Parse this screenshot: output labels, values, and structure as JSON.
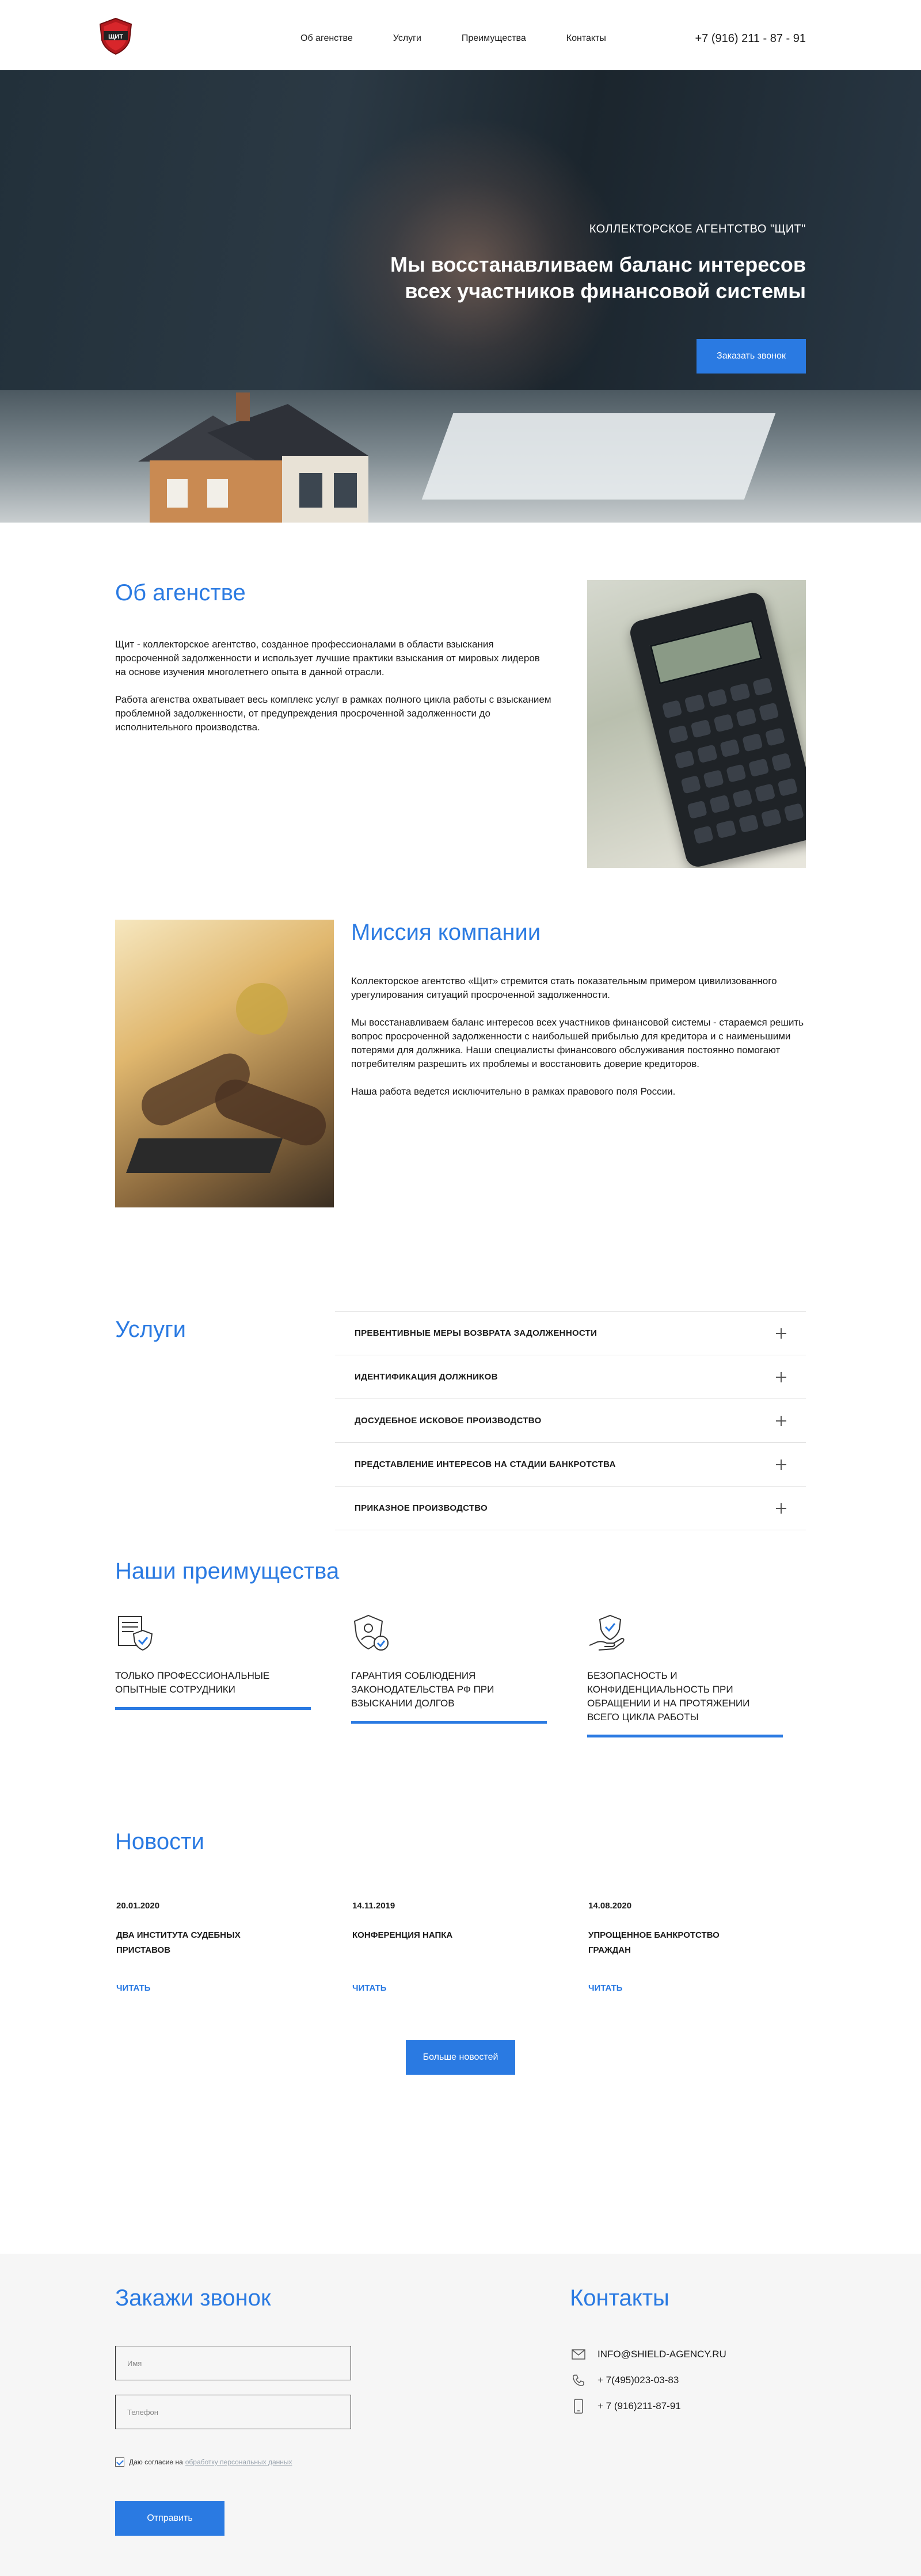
{
  "header": {
    "nav": [
      "Об агенстве",
      "Услуги",
      "Преимущества",
      "Контакты"
    ],
    "phone": "+7 (916) 211 - 87 - 91"
  },
  "hero": {
    "subtitle": "КОЛЛЕКТОРСКОЕ АГЕНТСТВО \"ЩИТ\"",
    "title": "Мы восстанавливаем баланс интересов всех участников финансовой системы",
    "button": "Заказать звонок"
  },
  "about": {
    "title": "Об агенстве",
    "paragraphs": [
      "Щит - коллекторское агентство, созданное профессионалами в области взыскания просроченной задолженности и использует лучшие практики взыскания от мировых лидеров на основе изучения многолетнего опыта в данной отрасли.",
      "Работа агенства охватывает весь комплекс услуг в рамках полного цикла работы с взысканием проблемной задолженности, от предупреждения просроченной задолженности до исполнительного производства."
    ]
  },
  "mission": {
    "title": "Миссия компании",
    "paragraphs": [
      "Коллекторское агентство «Щит» стремится стать показательным примером цивилизованного урегулирования ситуаций просроченной задолженности.",
      "Мы восстанавливаем баланс интересов всех участников финансовой системы - стараемся решить вопрос просроченной задолженности с наибольшей прибылью для кредитора и с наименьшими потерями для должника. Наши специалисты финансового обслуживания постоянно помогают потребителям разрешить их проблемы и восстановить доверие кредиторов.",
      "Наша работа ведется исключительно в рамках правового поля России."
    ]
  },
  "services": {
    "title": "Услуги",
    "items": [
      "ПРЕВЕНТИВНЫЕ МЕРЫ ВОЗВРАТА ЗАДОЛЖЕННОСТИ",
      "ИДЕНТИФИКАЦИЯ ДОЛЖНИКОВ",
      "ДОСУДЕБНОЕ ИСКОВОЕ ПРОИЗВОДСТВО",
      "ПРЕДСТАВЛЕНИЕ ИНТЕРЕСОВ НА СТАДИИ БАНКРОТСТВА",
      "ПРИКАЗНОЕ ПРОИЗВОДСТВО"
    ]
  },
  "advantages": {
    "title": "Наши преимущества",
    "items": [
      {
        "label": "ТОЛЬКО ПРОФЕССИОНАЛЬНЫЕ ОПЫТНЫЕ СОТРУДНИКИ",
        "icon": "certificate-icon"
      },
      {
        "label": "ГАРАНТИЯ СОБЛЮДЕНИЯ ЗАКОНОДАТЕЛЬСТВА РФ ПРИ ВЗЫСКАНИИ ДОЛГОВ",
        "icon": "law-shield-icon"
      },
      {
        "label": "БЕЗОПАСНОСТЬ И КОНФИДЕНЦИАЛЬНОСТЬ ПРИ ОБРАЩЕНИИ И НА ПРОТЯЖЕНИИ ВСЕГО ЦИКЛА РАБОТЫ",
        "icon": "hand-shield-icon"
      }
    ]
  },
  "news": {
    "title": "Новости",
    "items": [
      {
        "date": "20.01.2020",
        "title": "ДВА ИНСТИТУТА СУДЕБНЫХ ПРИСТАВОВ",
        "read": "ЧИТАТЬ"
      },
      {
        "date": "14.11.2019",
        "title": "КОНФЕРЕНЦИЯ НАПКА",
        "read": "ЧИТАТЬ"
      },
      {
        "date": "14.08.2020",
        "title": "УПРОЩЕННОЕ БАНКРОТСТВО ГРАЖДАН",
        "read": "ЧИТАТЬ"
      }
    ],
    "more_button": "Больше новостей"
  },
  "callback": {
    "title": "Закажи звонок",
    "name_placeholder": "Имя",
    "phone_placeholder": "Телефон",
    "agree_text": "Даю согласие на",
    "agree_link": "обработку персональных данных",
    "submit": "Отправить"
  },
  "contacts": {
    "title": "Контакты",
    "email": "INFO@SHIELD-AGENCY.RU",
    "phone1": "+ 7(495)023-03-83",
    "phone2": "+ 7 (916)211-87-91"
  },
  "colors": {
    "accent": "#2a7ae2",
    "logo_red": "#b3191e"
  }
}
